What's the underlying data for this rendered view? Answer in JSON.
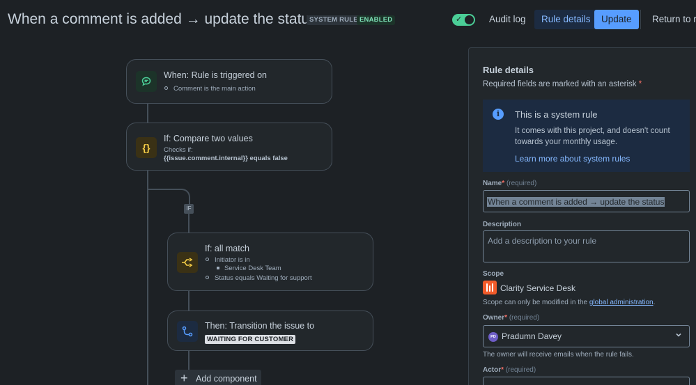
{
  "header": {
    "title": "When a comment is added → update the status",
    "badge_system": "SYSTEM RULE",
    "badge_enabled": "ENABLED",
    "toggle_icon": "✓",
    "audit_log": "Audit log",
    "rule_details": "Rule details",
    "update": "Update",
    "return": "Return to ru"
  },
  "canvas": {
    "trigger": {
      "title": "When: Rule is triggered on",
      "detail": "Comment is the main action"
    },
    "compare": {
      "icon": "{}",
      "title": "If: Compare two values",
      "detail_label": "Checks if:",
      "detail_value": "{{issue.comment.internal}} equals false"
    },
    "if_label": "IF",
    "all_match": {
      "title": "If: all match",
      "cond1": "Initiator is in",
      "cond1_sub": "Service Desk Team",
      "cond2": "Status equals Waiting for support"
    },
    "transition": {
      "title": "Then: Transition the issue to",
      "status": "WAITING FOR CUSTOMER"
    },
    "add_component": "Add component"
  },
  "panel": {
    "title": "Rule details",
    "required_note": "Required fields are marked with an asterisk",
    "asterisk": "*",
    "info": {
      "title": "This is a system rule",
      "body": "It comes with this project, and doesn't count towards your monthly usage.",
      "link": "Learn more about system rules"
    },
    "name_label": "Name",
    "required_text": "(required)",
    "name_value": "When a comment is added → update the status",
    "description_label": "Description",
    "description_placeholder": "Add a description to your rule",
    "scope_label": "Scope",
    "scope_value": "Clarity Service Desk",
    "scope_note": "Scope can only be modified in the",
    "scope_link": "global administration",
    "scope_note_end": ".",
    "owner_label": "Owner",
    "owner_initials": "PD",
    "owner_value": "Pradumn Davey",
    "owner_note": "The owner will receive emails when the rule fails.",
    "actor_label": "Actor"
  },
  "colors": {
    "accent": "#579dff",
    "enabled": "#4bce97",
    "background": "#1d2125"
  }
}
